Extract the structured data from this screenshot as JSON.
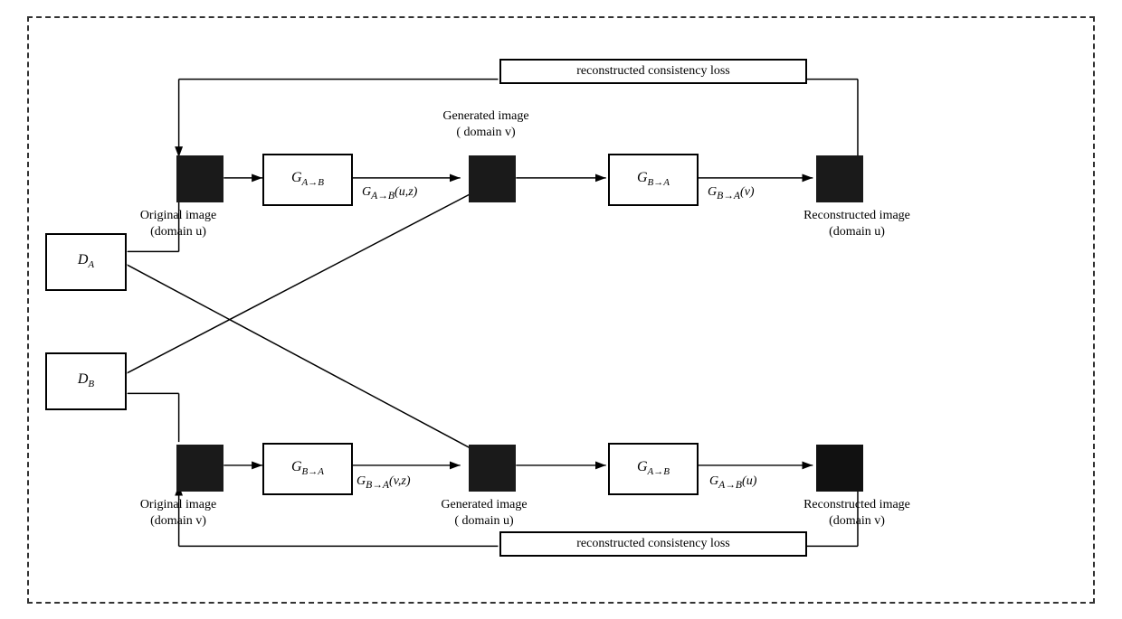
{
  "diagram": {
    "title": "reconstructed consistency loss",
    "outer_border": "dashed",
    "top_loss_label": "reconstructed consistency loss",
    "bottom_loss_label": "reconstructed consistency loss",
    "top_row": {
      "original_label": "Original image\n(domain u)",
      "generator1_label": "G_{A→B}",
      "generated_label": "Generated image\n( domain v)",
      "formula1_label": "G_{A→B}(u,z)",
      "generator2_label": "G_{B→A}",
      "reconstructed_label": "Reconstructed image\n(domain u)",
      "formula2_label": "G_{B→A}(v)"
    },
    "bottom_row": {
      "original_label": "Original image\n(domain v)",
      "generator1_label": "G_{B→A}",
      "generated_label": "Generated image\n( domain u)",
      "formula1_label": "G_{B→A}(v,z)",
      "generator2_label": "G_{A→B}",
      "reconstructed_label": "Reconstructed image\n(domain v)",
      "formula2_label": "G_{A→B}(u)"
    },
    "discriminators": {
      "da_label": "D_A",
      "db_label": "D_B"
    }
  }
}
